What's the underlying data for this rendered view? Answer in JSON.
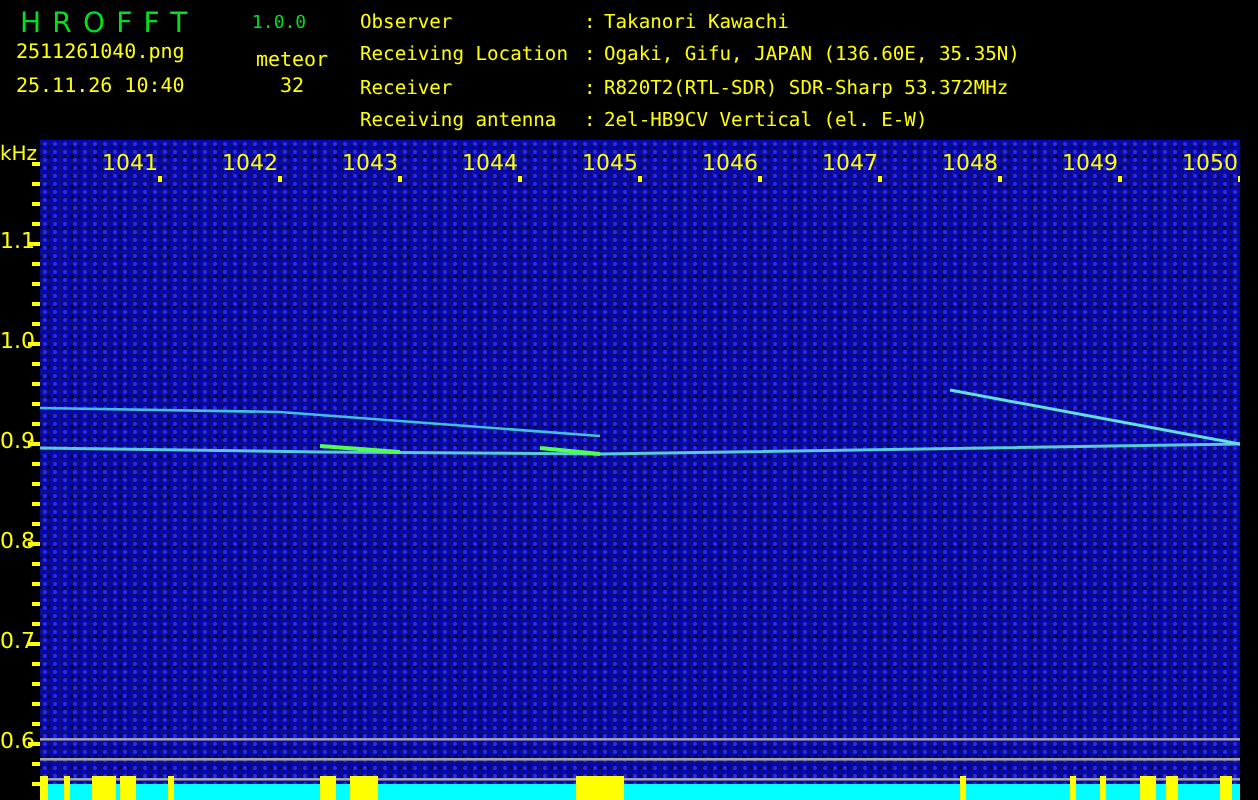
{
  "app": {
    "name": "HROFFT",
    "version": "1.0.0"
  },
  "file": {
    "name": "2511261040.png",
    "timestamp": "25.11.26 10:40"
  },
  "meteor": {
    "label": "meteor",
    "count": "32"
  },
  "station": [
    {
      "label": "Observer",
      "separator": ":",
      "value": "Takanori Kawachi"
    },
    {
      "label": "Receiving Location",
      "separator": ":",
      "value": "Ogaki, Gifu, JAPAN (136.60E, 35.35N)"
    },
    {
      "label": "Receiver",
      "separator": ":",
      "value": "R820T2(RTL-SDR) SDR-Sharp 53.372MHz"
    },
    {
      "label": "Receiving antenna",
      "separator": ":",
      "value": "2el-HB9CV Vertical (el. E-W)"
    }
  ],
  "spectrogram": {
    "unit": "kHz",
    "x_labels": [
      "1041",
      "1042",
      "1043",
      "1044",
      "1045",
      "1046",
      "1047",
      "1048",
      "1049",
      "1050"
    ],
    "y_labels": [
      "1.1",
      "1.0",
      "0.9",
      "0.8",
      "0.7",
      "0.6"
    ]
  }
}
